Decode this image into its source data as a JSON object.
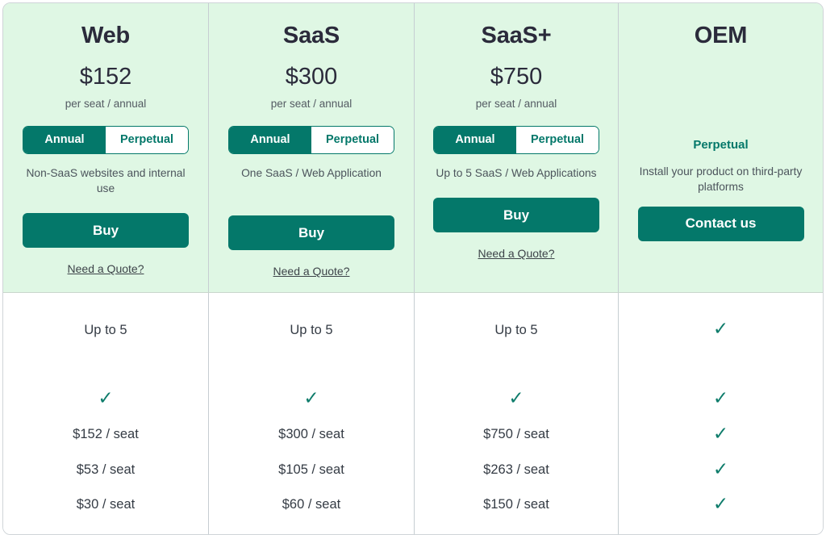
{
  "accent": {
    "teal": "#04786a",
    "header_bg": "#dff7e4",
    "check_green": "#0e7c6b",
    "text_dark": "#2b2b3b",
    "text_muted": "#4c545c"
  },
  "plans": [
    {
      "title": "Web",
      "price": "$152",
      "period": "per seat / annual",
      "toggle": {
        "active": "Annual",
        "inactive": "Perpetual"
      },
      "description": "Non-SaaS websites and internal use",
      "cta": "Buy",
      "quote_link": "Need a Quote?"
    },
    {
      "title": "SaaS",
      "price": "$300",
      "period": "per seat / annual",
      "toggle": {
        "active": "Annual",
        "inactive": "Perpetual"
      },
      "description": "One SaaS / Web Application",
      "cta": "Buy",
      "quote_link": "Need a Quote?"
    },
    {
      "title": "SaaS+",
      "price": "$750",
      "period": "per seat / annual",
      "toggle": {
        "active": "Annual",
        "inactive": "Perpetual"
      },
      "description": "Up to 5 SaaS / Web Applications",
      "cta": "Buy",
      "quote_link": "Need a Quote?"
    },
    {
      "title": "OEM",
      "term_label": "Perpetual",
      "description": "Install your product on third-party platforms",
      "cta": "Contact us"
    }
  ],
  "feature_table": {
    "columns": [
      "Web",
      "SaaS",
      "SaaS+",
      "OEM"
    ],
    "cells": {
      "web": [
        "Up to 5",
        "check",
        "$152 / seat",
        "$53 / seat",
        "$30 / seat"
      ],
      "saas": [
        "Up to 5",
        "check",
        "$300 / seat",
        "$105 / seat",
        "$60 / seat"
      ],
      "saasplus": [
        "Up to 5",
        "check",
        "$750 / seat",
        "$263 / seat",
        "$150 / seat"
      ],
      "oem": [
        "check",
        "check",
        "check",
        "check",
        "check"
      ]
    }
  },
  "icons": {
    "check": "✓"
  }
}
